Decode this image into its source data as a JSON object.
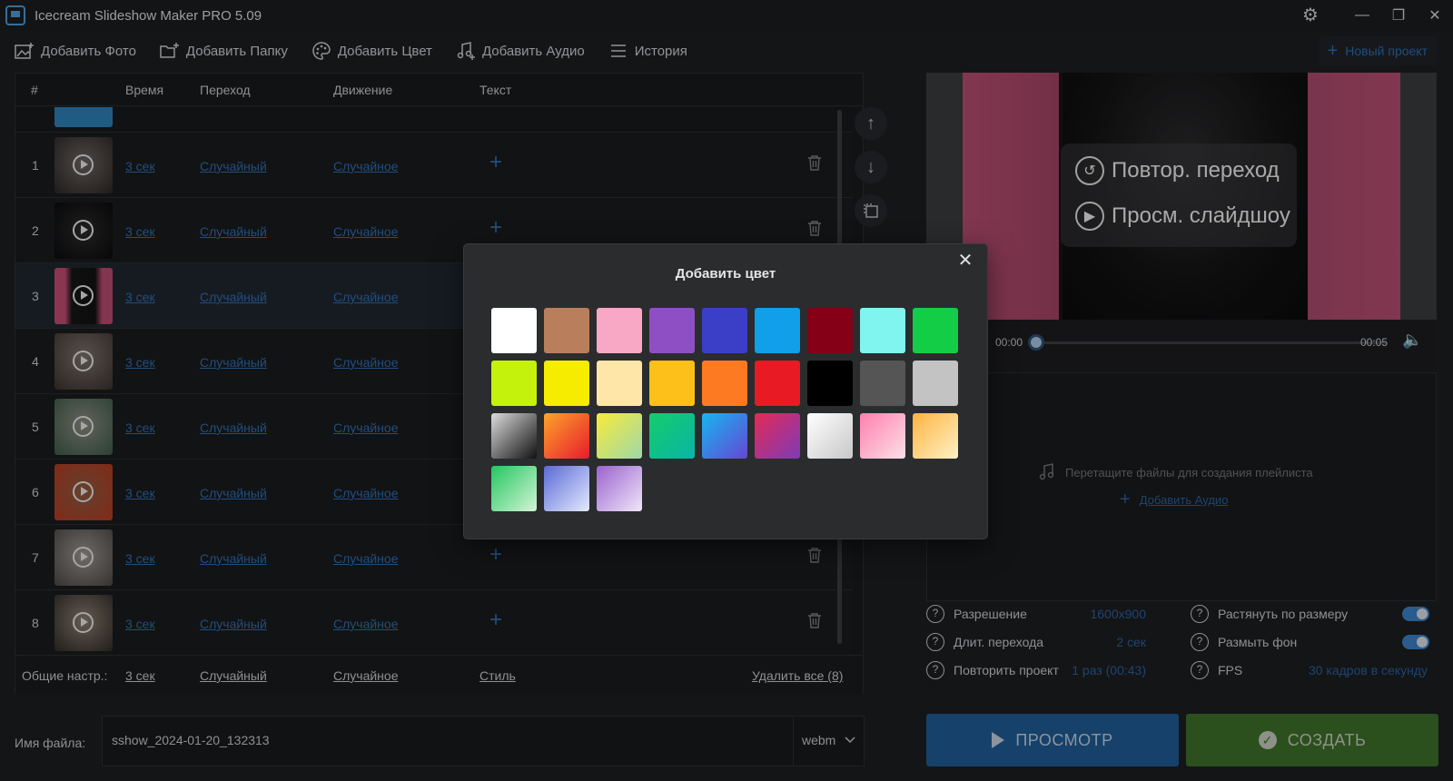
{
  "app": {
    "title": "Icecream Slideshow Maker PRO 5.09"
  },
  "toolbar": {
    "add_photo": "Добавить Фото",
    "add_folder": "Добавить Папку",
    "add_color": "Добавить Цвет",
    "add_audio": "Добавить Аудио",
    "history": "История",
    "new_project": "Новый проект"
  },
  "table": {
    "headers": {
      "num": "#",
      "time": "Время",
      "transition": "Переход",
      "motion": "Движение",
      "text": "Текст"
    },
    "rows": [
      {
        "num": "1",
        "time": "3 сек",
        "transition": "Случайный",
        "motion": "Случайное"
      },
      {
        "num": "2",
        "time": "3 сек",
        "transition": "Случайный",
        "motion": "Случайное"
      },
      {
        "num": "3",
        "time": "3 сек",
        "transition": "Случайный",
        "motion": "Случайное"
      },
      {
        "num": "4",
        "time": "3 сек",
        "transition": "Случайный",
        "motion": "Случайное"
      },
      {
        "num": "5",
        "time": "3 сек",
        "transition": "Случайный",
        "motion": "Случайное"
      },
      {
        "num": "6",
        "time": "3 сек",
        "transition": "Случайный",
        "motion": "Случайное"
      },
      {
        "num": "7",
        "time": "3 сек",
        "transition": "Случайный",
        "motion": "Случайное"
      },
      {
        "num": "8",
        "time": "3 сек",
        "transition": "Случайный",
        "motion": "Случайное"
      }
    ],
    "selected_row": "3"
  },
  "footer_settings": {
    "label": "Общие настр.:",
    "time": "3 сек",
    "transition": "Случайный",
    "motion": "Случайное",
    "style": "Стиль",
    "delete_all": "Удалить все (8)"
  },
  "preview": {
    "repeat_transition": "Повтор. переход",
    "view_slideshow": "Просм. слайдшоу",
    "time_start": "00:00",
    "time_end": "00:05"
  },
  "playlist": {
    "drop_text": "Перетащите файлы для создания плейлиста",
    "add_audio": "Добавить Аудио"
  },
  "settings": {
    "resolution_label": "Разрешение",
    "resolution_value": "1600x900",
    "transition_duration_label": "Длит. перехода",
    "transition_duration_value": "2 сек",
    "repeat_label": "Повторить проект",
    "repeat_value": "1 раз (00:43)",
    "stretch_label": "Растянуть по размеру",
    "stretch_on": true,
    "blur_label": "Размыть фон",
    "blur_on": true,
    "fps_label": "FPS",
    "fps_value": "30 кадров в секунду"
  },
  "buttons": {
    "preview": "ПРОСМОТР",
    "create": "СОЗДАТЬ"
  },
  "file": {
    "label": "Имя файла:",
    "name": "sshow_2024-01-20_132313",
    "format": "webm"
  },
  "dialog": {
    "title": "Добавить цвет",
    "swatches": [
      "#ffffff",
      "#b97e5c",
      "#f8a8c5",
      "#8e4fc4",
      "#3b3fc8",
      "#109fe8",
      "#850017",
      "#80f5ef",
      "#14cd46",
      "#c4f20c",
      "#f5ec00",
      "#fde6a8",
      "#fdc01a",
      "#fd7a22",
      "#e81a24",
      "#000000",
      "#555555",
      "#c3c3c3",
      "linear-gradient(135deg,#dcdcdc,#111111)",
      "linear-gradient(135deg,#fda42a,#e71b2d)",
      "linear-gradient(135deg,#f8ea3a,#9fd8a8)",
      "linear-gradient(135deg,#14cd6a,#0bb4a6)",
      "linear-gradient(135deg,#16b6ef,#6646d5)",
      "linear-gradient(135deg,#e52a55,#7c3bb8)",
      "linear-gradient(135deg,#ffffff,#c8c8c8)",
      "linear-gradient(135deg,#ff7fae,#fde0e6)",
      "linear-gradient(135deg,#fdb440,#fff1c6)",
      "linear-gradient(135deg,#24c660,#d3f5d6)",
      "linear-gradient(135deg,#5a6ad8,#e4eafd)",
      "linear-gradient(135deg,#9a62cf,#f1e6fa)"
    ]
  }
}
